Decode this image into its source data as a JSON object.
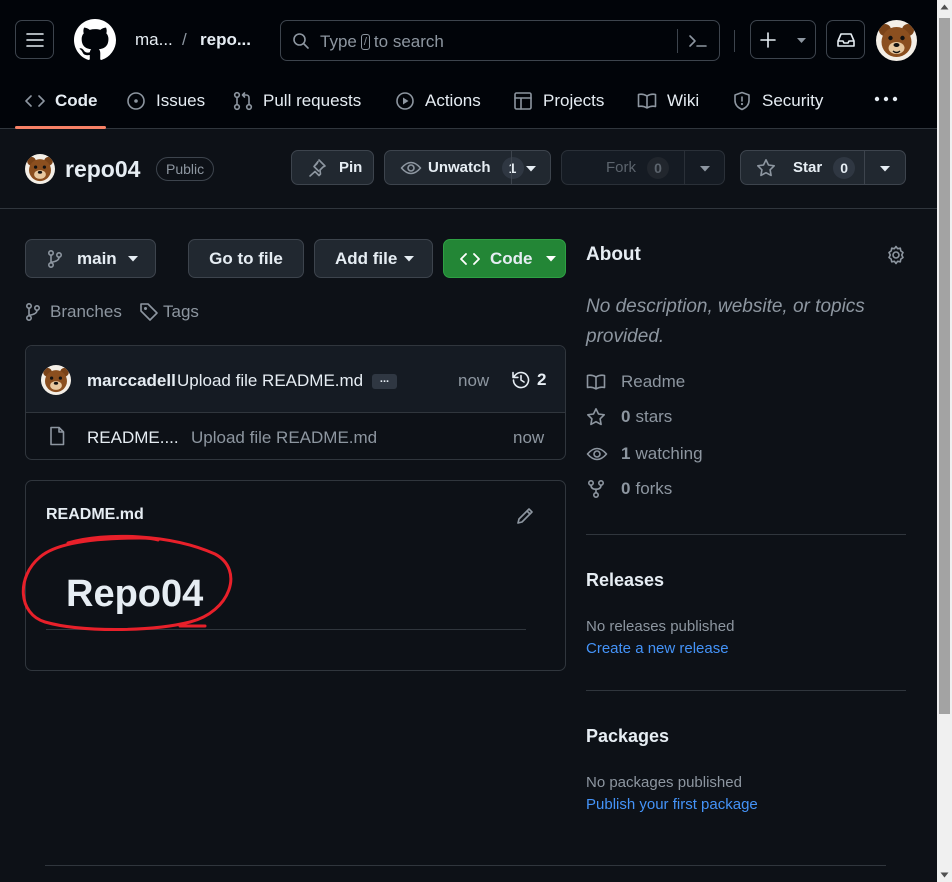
{
  "header": {
    "breadcrumb_owner": "ma...",
    "breadcrumb_sep": "/",
    "breadcrumb_repo": "repo...",
    "search_placeholder_before": "Type",
    "search_key": "/",
    "search_placeholder_after": "to search"
  },
  "tabs": [
    {
      "label": "Code",
      "icon": "code-icon",
      "selected": true
    },
    {
      "label": "Issues",
      "icon": "issue-icon"
    },
    {
      "label": "Pull requests",
      "icon": "pull-request-icon"
    },
    {
      "label": "Actions",
      "icon": "play-icon"
    },
    {
      "label": "Projects",
      "icon": "table-icon"
    },
    {
      "label": "Wiki",
      "icon": "book-icon"
    },
    {
      "label": "Security",
      "icon": "shield-icon"
    }
  ],
  "repo": {
    "name": "repo04",
    "visibility": "Public",
    "pin_label": "Pin",
    "watch_label": "Unwatch",
    "watch_count": "1",
    "fork_label": "Fork",
    "fork_count": "0",
    "star_label": "Star",
    "star_count": "0"
  },
  "toolbar": {
    "branch": "main",
    "goto_file": "Go to file",
    "add_file": "Add file",
    "code": "Code",
    "branches": "Branches",
    "tags": "Tags"
  },
  "commit": {
    "author": "marccadell",
    "message": "Upload file README.md",
    "ellipsis": "...",
    "time": "now",
    "count": "2"
  },
  "files": [
    {
      "name": "README....",
      "message": "Upload file README.md",
      "time": "now"
    }
  ],
  "readme": {
    "filename": "README.md",
    "heading": "Repo04"
  },
  "about": {
    "title": "About",
    "description": "No description, website, or topics provided.",
    "readme": "Readme",
    "stars_count": "0",
    "stars_label": "stars",
    "watching_count": "1",
    "watching_label": "watching",
    "forks_count": "0",
    "forks_label": "forks"
  },
  "releases": {
    "title": "Releases",
    "empty": "No releases published",
    "link": "Create a new release"
  },
  "packages": {
    "title": "Packages",
    "empty": "No packages published",
    "link": "Publish your first package"
  },
  "colors": {
    "background": "#0d1117",
    "header_bg": "#010409",
    "accent_underline": "#f78166",
    "code_button": "#238636",
    "link": "#4493f8",
    "annotation_red": "#e8202a"
  }
}
